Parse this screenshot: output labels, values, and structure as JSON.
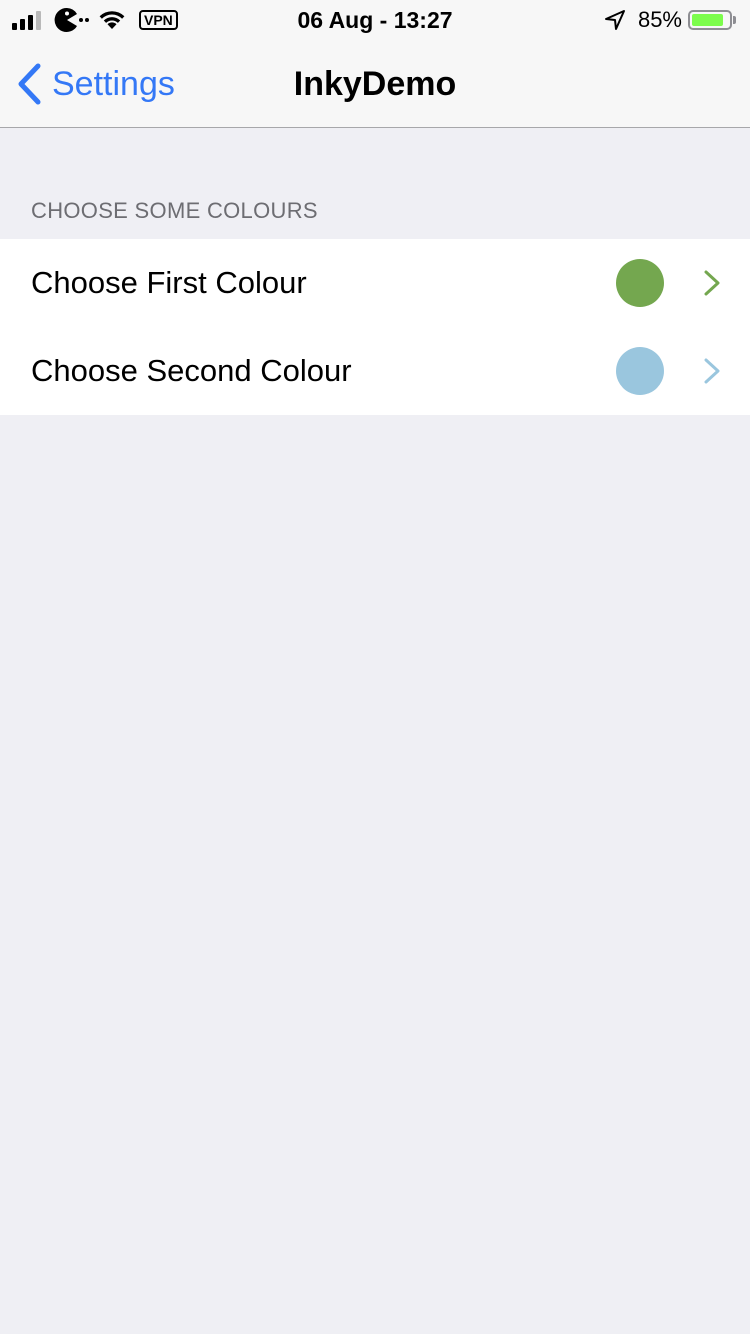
{
  "status_bar": {
    "time": "06 Aug - 13:27",
    "vpn_label": "VPN",
    "battery_percent": "85%",
    "battery_level": 0.85,
    "battery_color": "#7cfc4c"
  },
  "nav": {
    "back_label": "Settings",
    "title": "InkyDemo",
    "accent_color": "#3478f6"
  },
  "section": {
    "header": "CHOOSE SOME COLOURS",
    "rows": [
      {
        "label": "Choose First Colour",
        "swatch_color": "#74a74f",
        "chevron_color": "#74a74f"
      },
      {
        "label": "Choose Second Colour",
        "swatch_color": "#9ac6de",
        "chevron_color": "#9ac6de"
      }
    ]
  },
  "icons": {
    "signal": "cellular-signal-icon",
    "carrier": "pacman-icon",
    "wifi": "wifi-icon",
    "location": "location-arrow-icon",
    "back": "chevron-left-icon",
    "disclosure": "chevron-right-icon"
  }
}
